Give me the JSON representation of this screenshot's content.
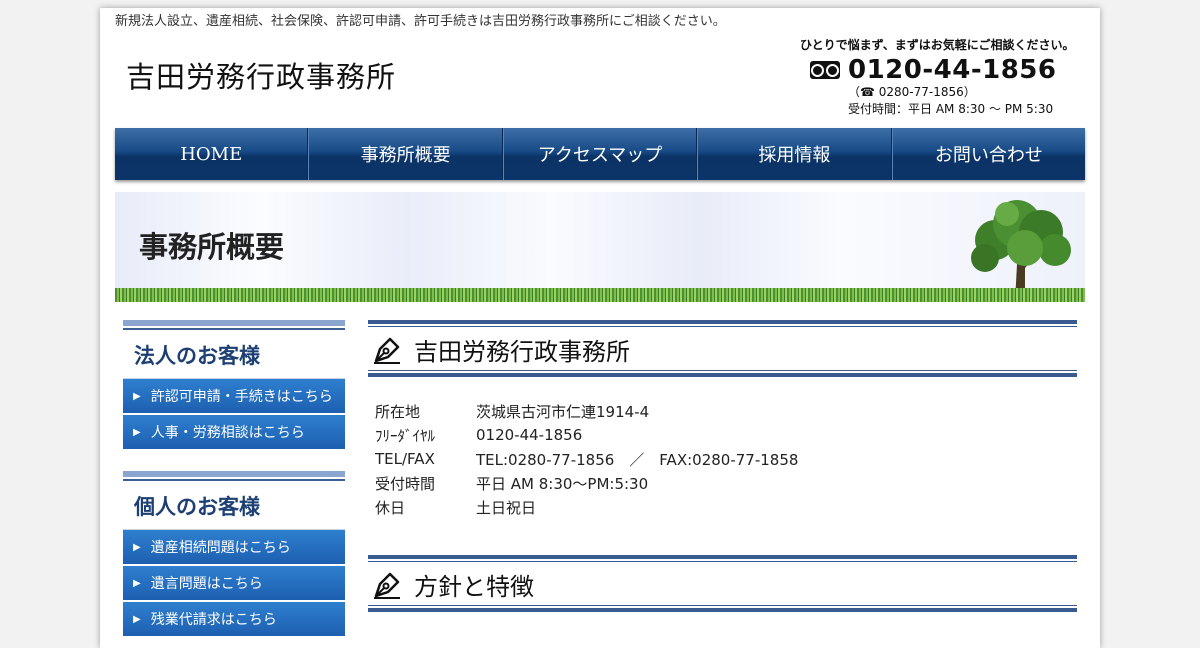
{
  "header": {
    "topline": "新規法人設立、遺産相続、社会保険、許認可申請、許可手続きは吉田労務行政事務所にご相談ください。",
    "site_title": "吉田労務行政事務所",
    "contact": {
      "tagline": "ひとりで悩まず、まずはお気軽にご相談ください。",
      "freedial_icon": "free-dial-icon",
      "freedial": "0120-44-1856",
      "tel": "（☎ 0280-77-1856）",
      "hours": "受付時間：平日 AM 8:30 〜 PM 5:30"
    }
  },
  "nav": {
    "items": [
      {
        "label": "HOME"
      },
      {
        "label": "事務所概要"
      },
      {
        "label": "アクセスマップ"
      },
      {
        "label": "採用情報"
      },
      {
        "label": "お問い合わせ"
      }
    ]
  },
  "banner": {
    "heading": "事務所概要"
  },
  "sidebar": {
    "corporate": {
      "title": "法人のお客様",
      "links": [
        {
          "label": "許認可申請・手続きはこちら"
        },
        {
          "label": "人事・労務相談はこちら"
        }
      ]
    },
    "personal": {
      "title": "個人のお客様",
      "links": [
        {
          "label": "遺産相続問題はこちら"
        },
        {
          "label": "遺言問題はこちら"
        },
        {
          "label": "残業代請求はこちら"
        }
      ]
    }
  },
  "main": {
    "office": {
      "title": "吉田労務行政事務所",
      "rows": [
        {
          "key": "所在地",
          "value": "茨城県古河市仁連1914-4"
        },
        {
          "key": "ﾌﾘｰﾀﾞｲﾔﾙ",
          "value": "0120-44-1856"
        },
        {
          "key": "TEL/FAX",
          "value": "TEL:0280-77-1856　／　FAX:0280-77-1858"
        },
        {
          "key": "受付時間",
          "value": "平日 AM 8:30〜PM:5:30"
        },
        {
          "key": "休日",
          "value": "土日祝日"
        }
      ]
    },
    "policy": {
      "title": "方針と特徴"
    }
  },
  "colors": {
    "nav": "#174a86",
    "accent": "#3a5a92",
    "sidebar_button": "#2f7fcf"
  }
}
